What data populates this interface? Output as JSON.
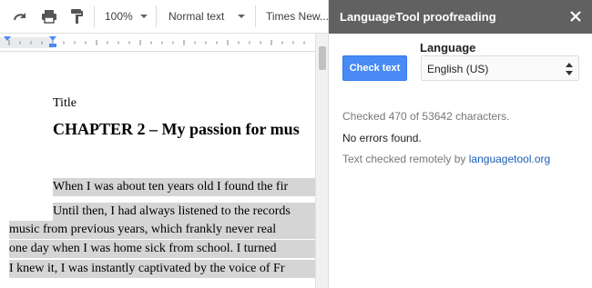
{
  "toolbar": {
    "zoom": "100%",
    "style": "Normal text",
    "font": "Times New..."
  },
  "document": {
    "title_label": "Title",
    "heading": "CHAPTER 2 – My passion for mus",
    "lines": [
      "When I was about ten years old I found the fir",
      "Until then, I had always listened to the records",
      "music from previous years, which frankly never real",
      "one day when I was home sick from school. I turned",
      "I knew it, I was instantly captivated by the voice of Fr"
    ]
  },
  "sidebar": {
    "title": "LanguageTool proofreading",
    "language_label": "Language",
    "check_button": "Check text",
    "language_value": "English (US)",
    "checked_status": "Checked 470 of 53642 characters.",
    "no_errors": "No errors found.",
    "remote_prefix": "Text checked remotely by",
    "remote_link": "languagetool.org"
  },
  "colors": {
    "sidebar_header": "#616161",
    "check_button": "#4a8af4",
    "link": "#1a5fb4",
    "highlight": "#d5d5d5"
  },
  "icons": [
    "redo-icon",
    "print-icon",
    "paint-format-icon",
    "close-icon",
    "select-arrows-icon"
  ]
}
